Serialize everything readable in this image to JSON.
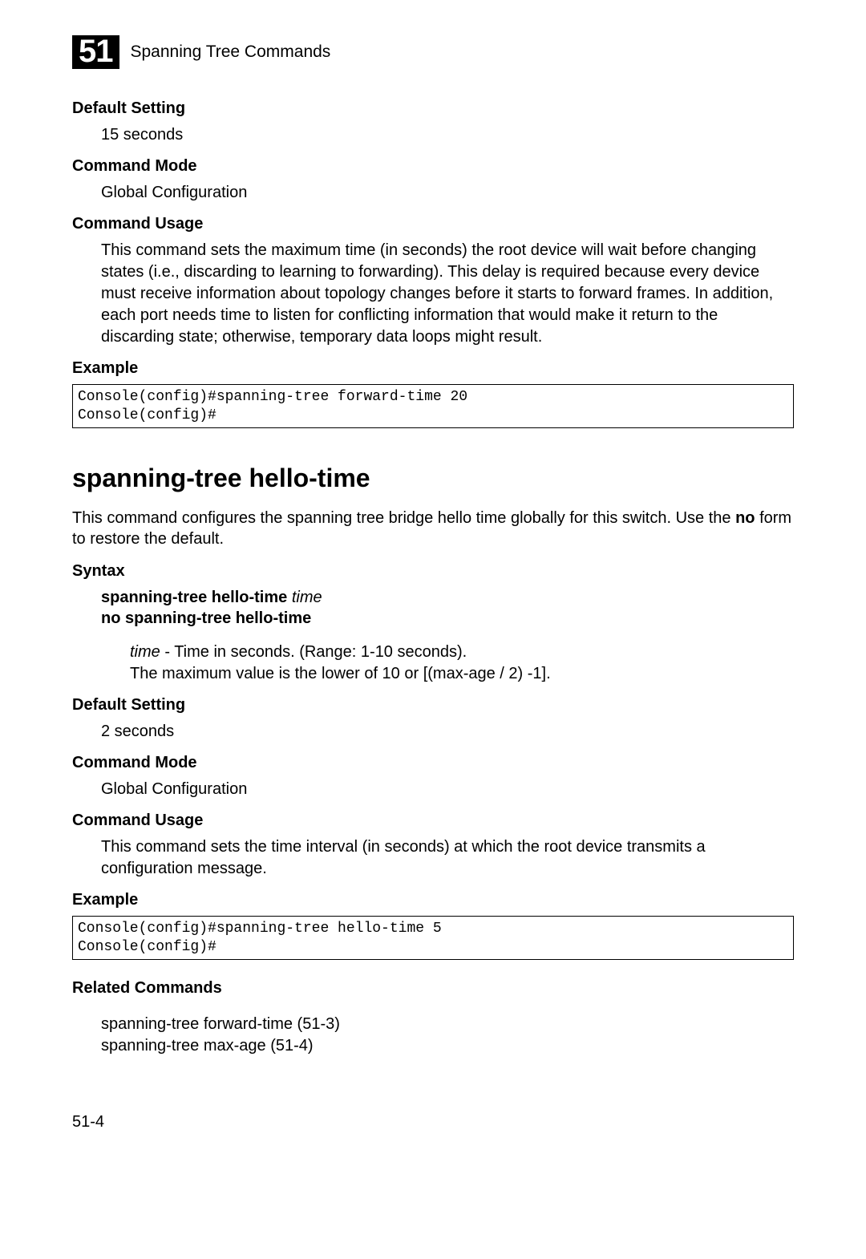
{
  "header": {
    "chapter_number": "51",
    "title": "Spanning Tree Commands"
  },
  "section1": {
    "default_setting_label": "Default Setting",
    "default_setting_value": "15 seconds",
    "command_mode_label": "Command Mode",
    "command_mode_value": "Global Configuration",
    "command_usage_label": "Command Usage",
    "command_usage_text": "This command sets the maximum time (in seconds) the root device will wait before changing states (i.e., discarding to learning to forwarding). This delay is required because every device must receive information about topology changes before it starts to forward frames. In addition, each port needs time to listen for conflicting information that would make it return to the discarding state; otherwise, temporary data loops might result.",
    "example_label": "Example",
    "example_code": "Console(config)#spanning-tree forward-time 20\nConsole(config)#"
  },
  "section2": {
    "title": "spanning-tree hello-time",
    "intro_part1": "This command configures the spanning tree bridge hello time globally for this switch. Use the ",
    "intro_bold": "no",
    "intro_part2": " form to restore the default.",
    "syntax_label": "Syntax",
    "syntax_line1_bold": "spanning-tree hello-time ",
    "syntax_line1_italic": "time",
    "syntax_line2_bold": "no spanning-tree hello-time",
    "param_italic": "time",
    "param_text1": " - Time in seconds. (Range: 1-10 seconds).",
    "param_text2": "The maximum value is the lower of 10 or [(max-age / 2) -1].",
    "default_setting_label": "Default Setting",
    "default_setting_value": "2 seconds",
    "command_mode_label": "Command Mode",
    "command_mode_value": "Global Configuration",
    "command_usage_label": "Command Usage",
    "command_usage_text": "This command sets the time interval (in seconds) at which the root device transmits a configuration message.",
    "example_label": "Example",
    "example_code": "Console(config)#spanning-tree hello-time 5\nConsole(config)#",
    "related_label": "Related Commands",
    "related1": "spanning-tree forward-time (51-3)",
    "related2": "spanning-tree max-age (51-4)"
  },
  "page_number": "51-4"
}
